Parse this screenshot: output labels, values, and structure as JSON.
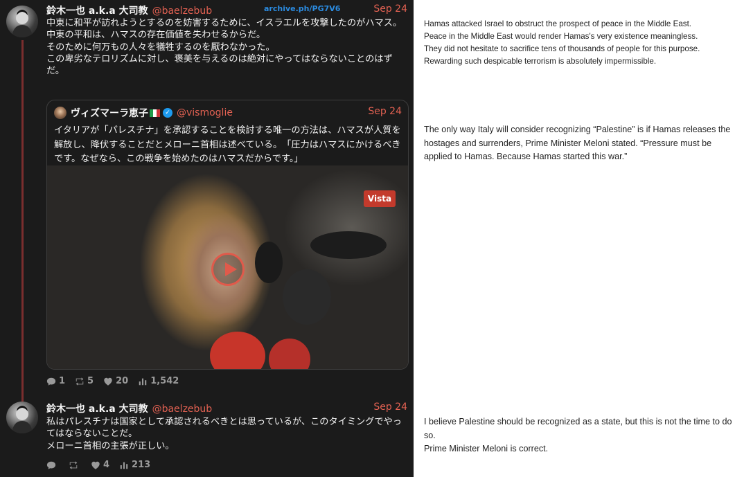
{
  "tweet1": {
    "name": "鈴木一也 a.k.a 大司教",
    "handle": "@baelzebub",
    "archive": "archive.ph/PG7V6",
    "date": "Sep 24",
    "lines": [
      "中東に和平が訪れようとするのを妨害するために、イスラエルを攻撃したのがハマス。",
      "中東の平和は、ハマスの存在価値を失わせるからだ。",
      "そのために何万もの人々を犠牲するのを厭わなかった。",
      "この卑劣なテロリズムに対し、褒美を与えるのは絶対にやってはならないことのはずだ。"
    ],
    "stats": {
      "replies": "1",
      "retweets": "5",
      "likes": "20",
      "views": "1,542"
    }
  },
  "quote": {
    "name": "ヴィズマーラ恵子",
    "handle": "@vismoglie",
    "date": "Sep 24",
    "text": "イタリアが「パレスチナ」を承認することを検討する唯一の方法は、ハマスが人質を解放し、降伏することだとメローニ首相は述べている。　「圧力はハマスにかけるべきです。なぜなら、この戦争を始めたのはハマスだからです。」",
    "video_logo": "Vista",
    "mic_label": "Vista"
  },
  "tweet2": {
    "name": "鈴木一也 a.k.a 大司教",
    "handle": "@baelzebub",
    "date": "Sep 24",
    "lines": [
      "私はパレスチナは国家として承認されるべきとは思っているが、このタイミングでやってはならないことだ。",
      "メローニ首相の主張が正しい。"
    ],
    "stats": {
      "replies": "",
      "retweets": "",
      "likes": "4",
      "views": "213"
    }
  },
  "translations": {
    "t1": [
      "Hamas attacked Israel to obstruct the prospect of peace in the Middle East.",
      "Peace in the Middle East would render Hamas's very existence meaningless.",
      "They did not hesitate to sacrifice tens of thousands of people for this purpose.",
      "Rewarding such despicable terrorism is absolutely impermissible."
    ],
    "t2": "The only way Italy will consider recognizing “Palestine” is if Hamas releases the hostages and surrenders, Prime Minister Meloni stated. “Pressure must be applied to Hamas. Because Hamas started this war.”",
    "t3": [
      "I believe Palestine should be recognized as a state, but this is not the time to do so.",
      "Prime Minister Meloni is correct."
    ]
  },
  "colors": {
    "accent": "#e26152",
    "link": "#2b8be0",
    "thread_line": "#7a2e2e",
    "background_dark": "#1b1b1b"
  },
  "icons": [
    "reply-icon",
    "retweet-icon",
    "like-icon",
    "views-icon",
    "verified-icon",
    "italy-flag-icon",
    "play-icon"
  ]
}
